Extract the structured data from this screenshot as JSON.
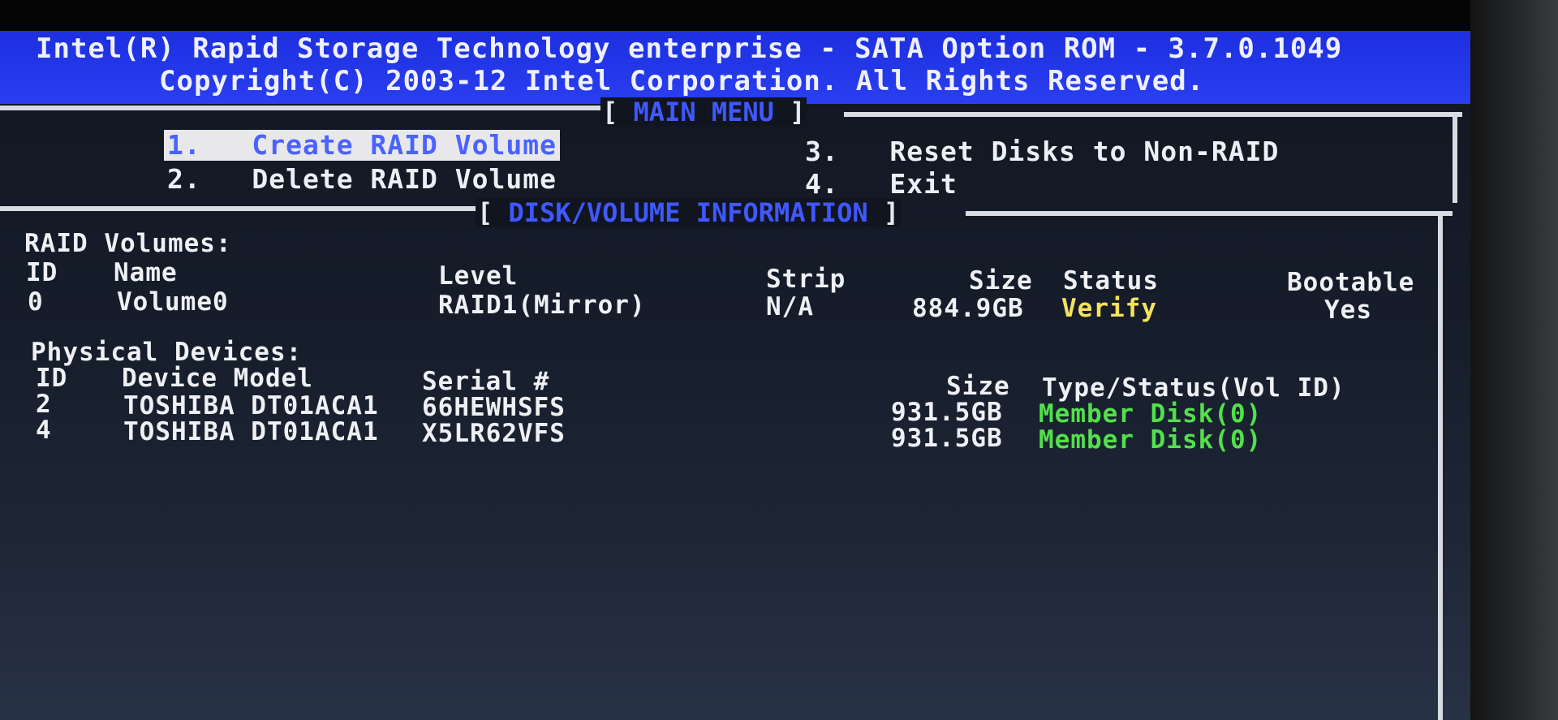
{
  "header": {
    "line1": "Intel(R) Rapid Storage Technology enterprise - SATA Option ROM - 3.7.0.1049",
    "line2": "Copyright(C) 2003-12 Intel Corporation.  All Rights Reserved."
  },
  "main_menu": {
    "title_left": "[ ",
    "title": "MAIN MENU",
    "title_right": " ]",
    "items": [
      {
        "num": "1.",
        "label": "Create RAID Volume"
      },
      {
        "num": "2.",
        "label": "Delete RAID Volume"
      },
      {
        "num": "3.",
        "label": "Reset Disks to Non-RAID"
      },
      {
        "num": "4.",
        "label": "Exit"
      }
    ]
  },
  "disk_info": {
    "title_left": "[ ",
    "title": "DISK/VOLUME INFORMATION",
    "title_right": " ]",
    "raid_heading": "RAID Volumes:",
    "raid_columns": {
      "id": "ID",
      "name": "Name",
      "level": "Level",
      "strip": "Strip",
      "size": "Size",
      "status": "Status",
      "bootable": "Bootable"
    },
    "raid_rows": [
      {
        "id": "0",
        "name": "Volume0",
        "level": "RAID1(Mirror)",
        "strip": "N/A",
        "size": "884.9GB",
        "status": "Verify",
        "bootable": "Yes"
      }
    ],
    "phys_heading": "Physical Devices:",
    "phys_columns": {
      "id": "ID",
      "model": "Device Model",
      "serial": "Serial #",
      "size": "Size",
      "type": "Type/Status(Vol ID)"
    },
    "phys_rows": [
      {
        "id": "2",
        "model": "TOSHIBA DT01ACA1",
        "serial": "66HEWHSFS",
        "size": "931.5GB",
        "type": "Member Disk(0)"
      },
      {
        "id": "4",
        "model": "TOSHIBA DT01ACA1",
        "serial": "X5LR62VFS",
        "size": "931.5GB",
        "type": "Member Disk(0)"
      }
    ]
  },
  "colors": {
    "title_bar": "#2a3ff0",
    "status_verify": "#f4e35a",
    "member_disk": "#52e04b",
    "section_title": "#3f58ff"
  }
}
